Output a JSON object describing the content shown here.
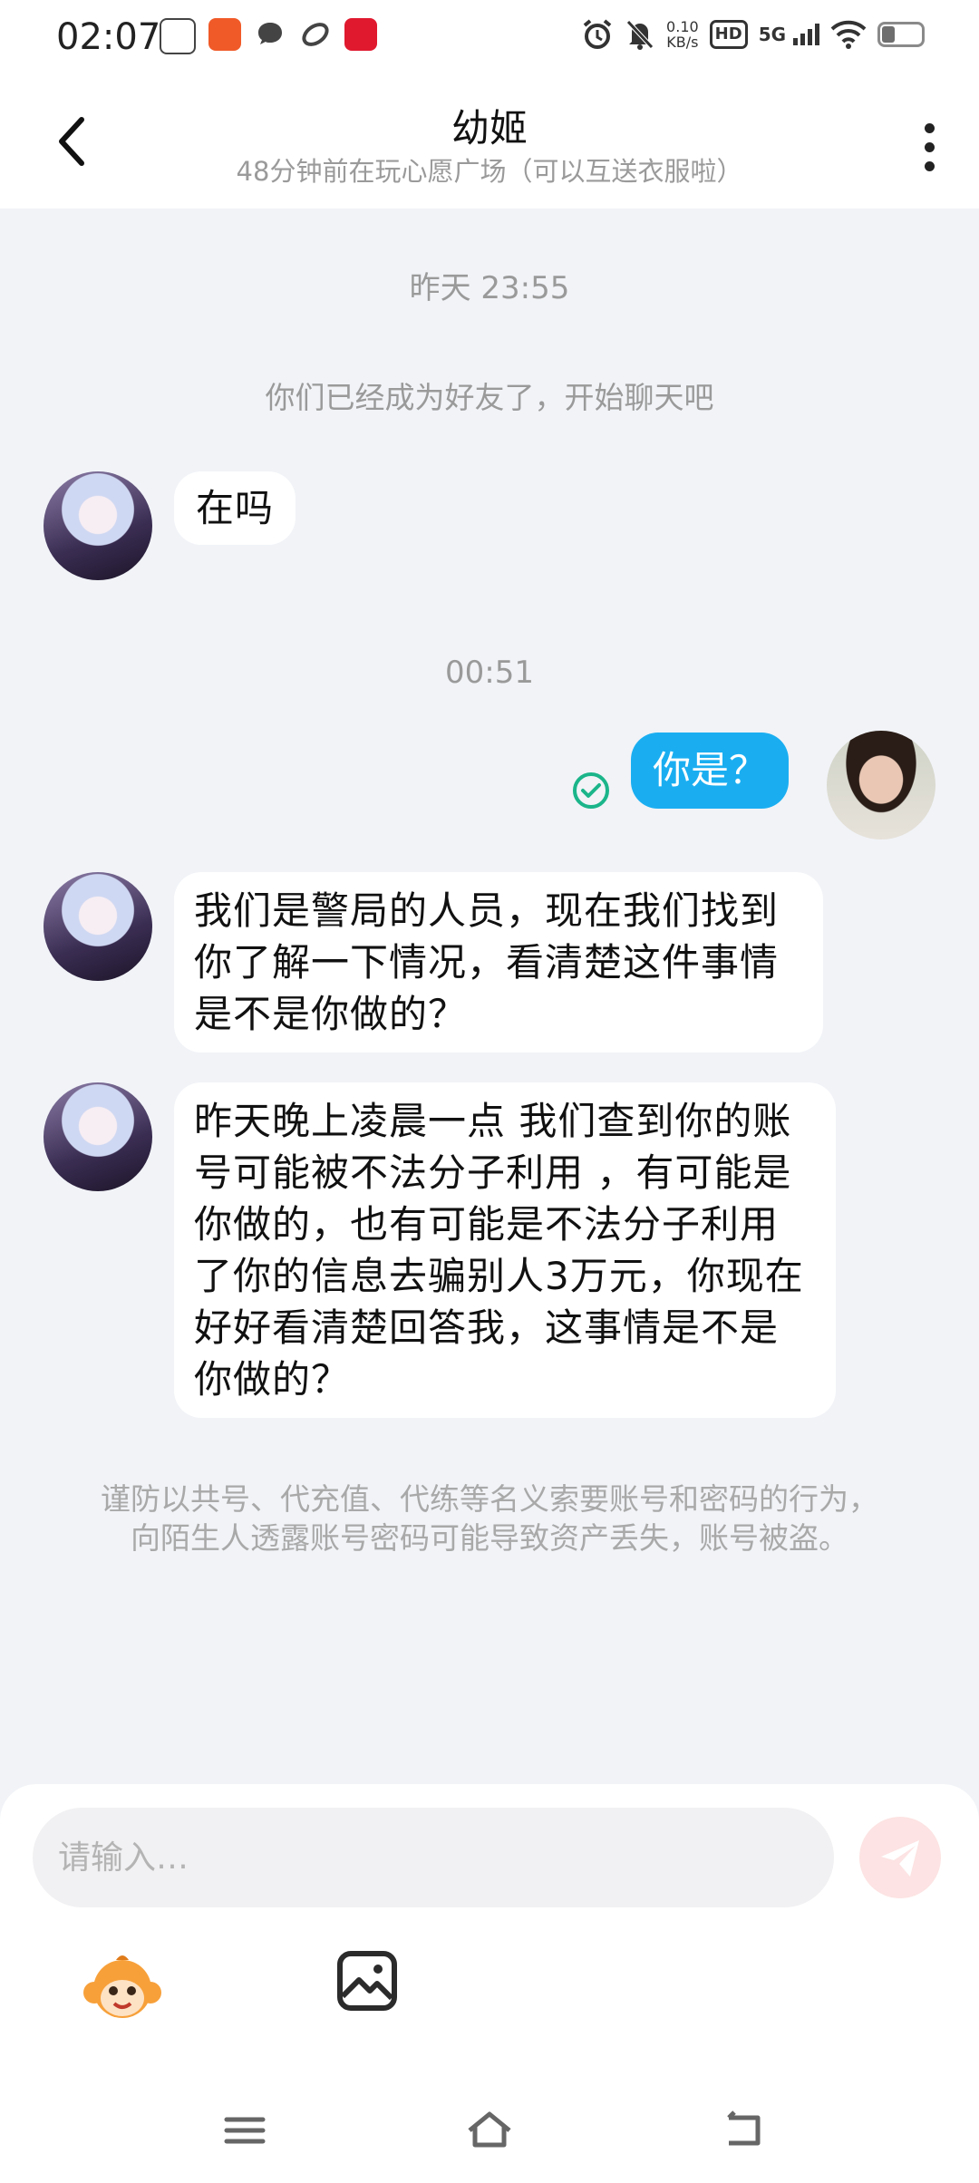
{
  "status_bar": {
    "time": "02:07",
    "speed_value": "0.10",
    "speed_unit": "KB/s",
    "hd": "HD",
    "network": "5G",
    "icons": [
      "alarm-icon",
      "mute-bell-icon",
      "wifi-icon",
      "battery-icon"
    ]
  },
  "header": {
    "title": "幼姬",
    "subtitle": "48分钟前在玩心愿广场（可以互送衣服啦）"
  },
  "chat": {
    "timestamp_1": "昨天 23:55",
    "friend_note": "你们已经成为好友了，开始聊天吧",
    "msg_1": "在吗",
    "timestamp_2": "00:51",
    "msg_me": "你是？",
    "msg_2": "我们是警局的人员，现在我们找到你了解一下情况，看清楚这件事情是不是你做的？",
    "msg_3": "昨天晚上凌晨一点 我们查到你的账号可能被不法分子利用 ，有可能是你做的，也有可能是不法分子利用了你的信息去骗别人3万元，你现在好好看清楚回答我，这事情是不是你做的？",
    "warning": "谨防以共号、代充值、代练等名义索要账号和密码的行为，向陌生人透露账号密码可能导致资产丢失，账号被盗。"
  },
  "input": {
    "placeholder": "请输入…",
    "value": ""
  },
  "colors": {
    "accent": "#1aaef1",
    "background": "#f1f3f7",
    "send_disabled": "#fde3e3",
    "read_check": "#1bb58a"
  }
}
